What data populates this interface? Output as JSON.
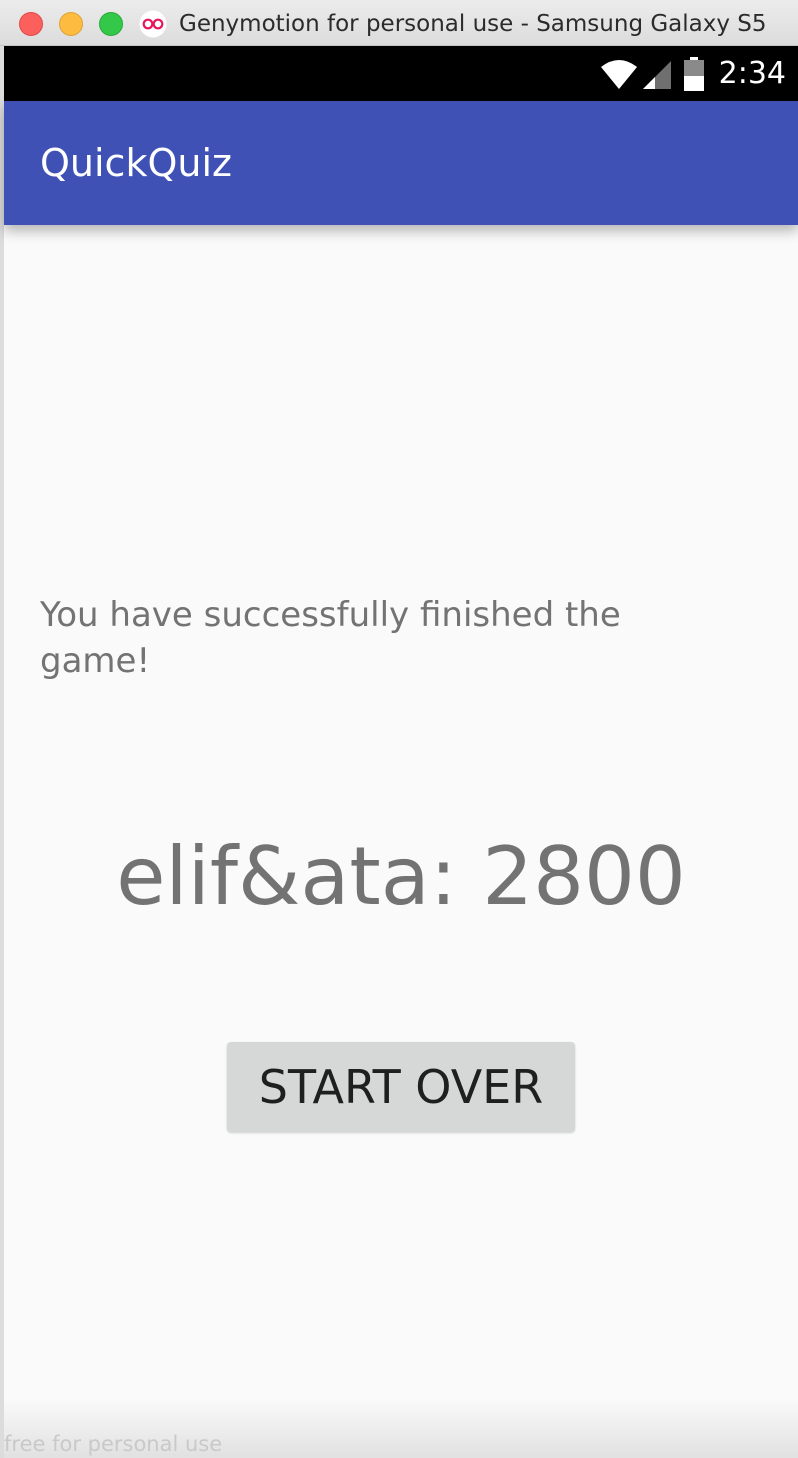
{
  "window": {
    "title": "Genymotion for personal use - Samsung Galaxy S5"
  },
  "status_bar": {
    "time": "2:34",
    "icons": [
      "wifi-icon",
      "cell-signal-icon",
      "battery-icon"
    ]
  },
  "app_bar": {
    "title": "QuickQuiz",
    "color": "#3f51b5"
  },
  "content": {
    "message": "You have successfully finished the game!",
    "score": "elif&ata: 2800",
    "start_over_label": "START OVER"
  },
  "watermark": "free for personal use"
}
